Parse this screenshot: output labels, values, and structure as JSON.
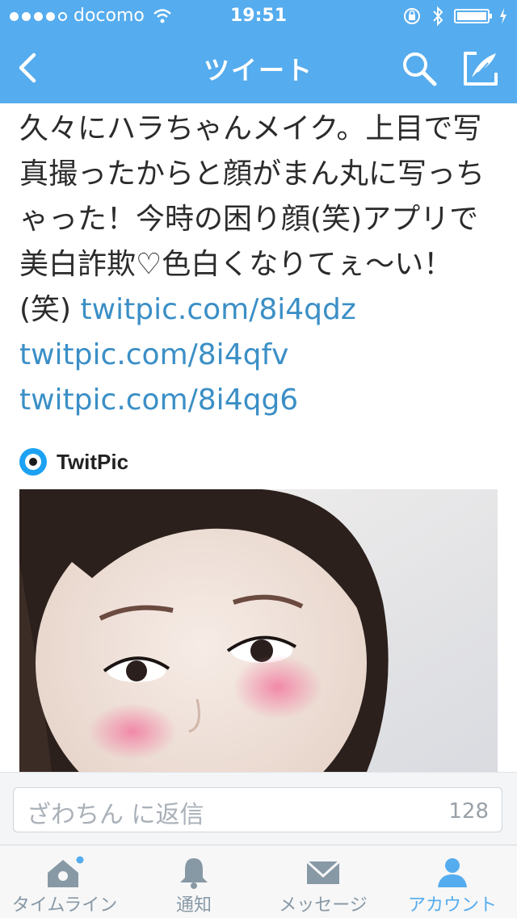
{
  "status_bar": {
    "carrier": "docomo",
    "time": "19:51"
  },
  "nav": {
    "title": "ツイート",
    "icons": [
      "back-chevron-icon",
      "search-icon",
      "compose-icon"
    ]
  },
  "tweet": {
    "text": "久々にハラちゃんメイク。上目で写真撮ったからと顔がまん丸に写っちゃった！今時の困り顔(笑)アプリで美白詐欺♡色白くなりてぇ〜い！(笑) ",
    "links": [
      "twitpic.com/8i4qdz",
      "twitpic.com/8i4qfv",
      "twitpic.com/8i4qg6"
    ]
  },
  "card": {
    "source_name": "TwitPic",
    "logo_icon": "twitpic-logo-icon"
  },
  "reply": {
    "placeholder": "ざわちん に返信",
    "char_count": "128"
  },
  "tabs": [
    {
      "label": "タイムライン",
      "icon": "home-icon"
    },
    {
      "label": "通知",
      "icon": "bell-icon"
    },
    {
      "label": "メッセージ",
      "icon": "envelope-icon"
    },
    {
      "label": "アカウント",
      "icon": "person-icon",
      "active": true
    }
  ],
  "colors": {
    "brand_blue": "#55acee",
    "link_blue": "#3b8fc6",
    "tab_inactive": "#8899a6"
  }
}
